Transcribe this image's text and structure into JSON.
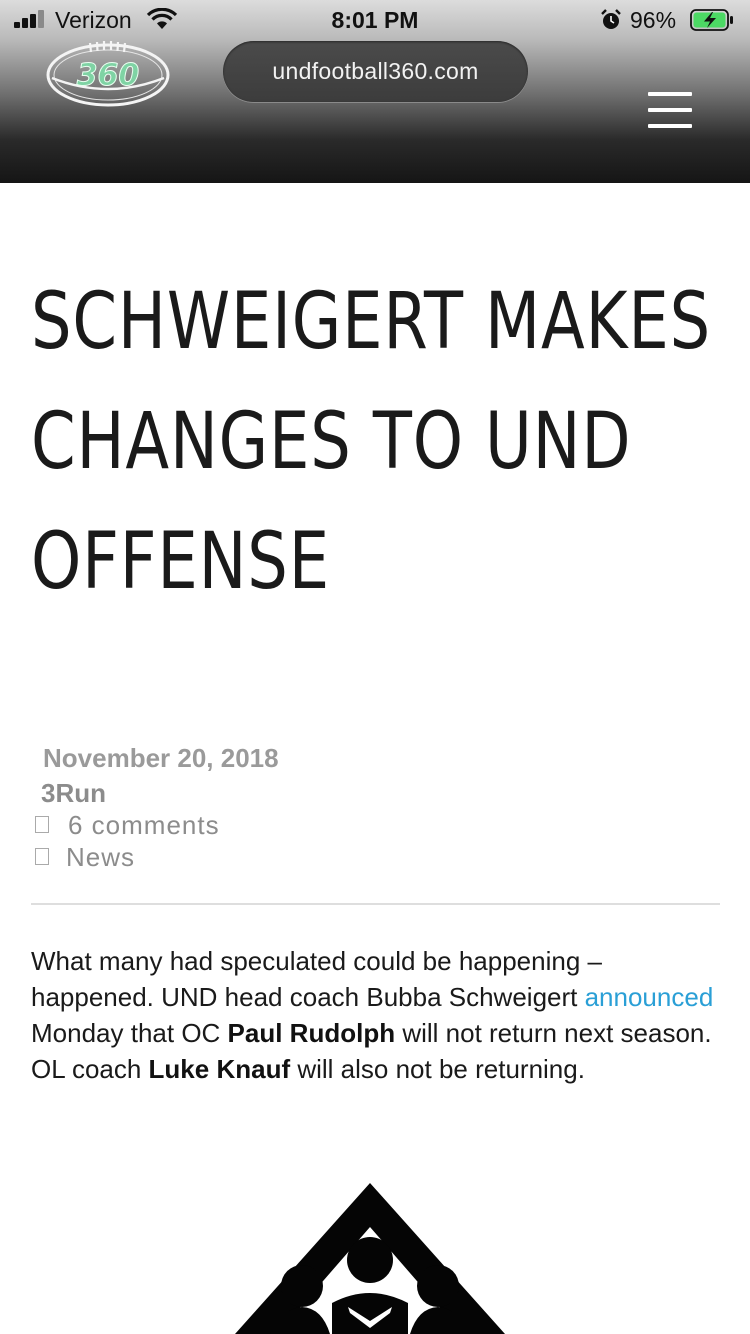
{
  "status_bar": {
    "carrier": "Verizon",
    "time": "8:01 PM",
    "battery_percent": "96%"
  },
  "header": {
    "logo_text": "360",
    "url": "undfootball360.com",
    "menu_icon": "hamburger-menu-icon"
  },
  "article": {
    "title": "SCHWEIGERT MAKES CHANGES TO UND OFFENSE",
    "date": "November 20, 2018",
    "author": "3Run",
    "comments": "6 comments",
    "category": "News",
    "body": {
      "part1": "What many had speculated could be happening – happened. UND head coach Bubba Schweigert ",
      "link": "announced",
      "part2": " Monday that OC ",
      "name1": "Paul Rudolph",
      "part3": " will not return next season. OL coach ",
      "name2": "Luke Knauf",
      "part4": " will also not be returning."
    }
  },
  "colors": {
    "link": "#2a9fd6",
    "logo_green": "#7fd3a4",
    "battery_green": "#4cd964"
  }
}
